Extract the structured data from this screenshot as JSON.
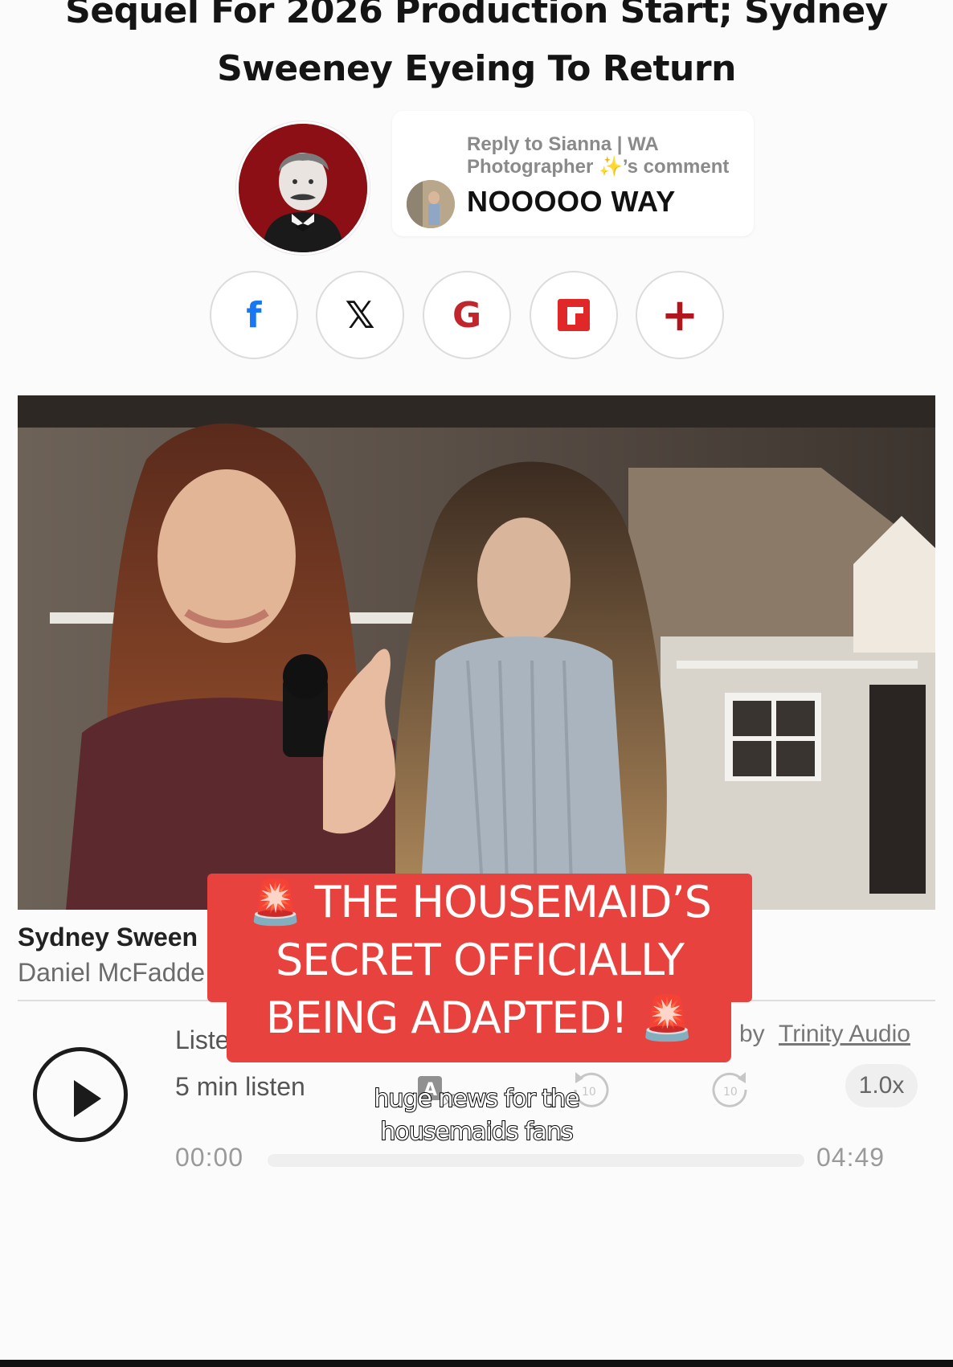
{
  "article": {
    "headline_line1": "Sequel For 2026 Production Start; Sydney",
    "headline_line2": "Sweeney Eyeing To Return"
  },
  "comment_reply": {
    "label": "Reply to Sianna | WA Photographer ✨’s comment",
    "text": "NOOOOO WAY"
  },
  "share": {
    "facebook": "f",
    "x": "𝕏",
    "google": "G",
    "more": "+"
  },
  "image_caption": {
    "title": "Sydney Sween",
    "credit": "Daniel McFadde"
  },
  "audio_player": {
    "listen_label": "Liste",
    "duration": "5 min listen",
    "by_label": "by",
    "provider": "Trinity Audio",
    "speed": "1.0x",
    "current_time": "00:00",
    "total_time": "04:49",
    "progress": 0
  },
  "overlay_banner": {
    "line1": "🚨 THE HOUSEMAID’S",
    "line2": "SECRET OFFICIALLY",
    "line3": "BEING ADAPTED! 🚨"
  },
  "subtitle": {
    "line1": "huge news for the",
    "line2": "housemaids fans"
  },
  "colors": {
    "banner": "#e8423f",
    "facebook": "#1877f2",
    "google": "#c0262c",
    "flipboard": "#e12828",
    "more": "#b0161c"
  }
}
